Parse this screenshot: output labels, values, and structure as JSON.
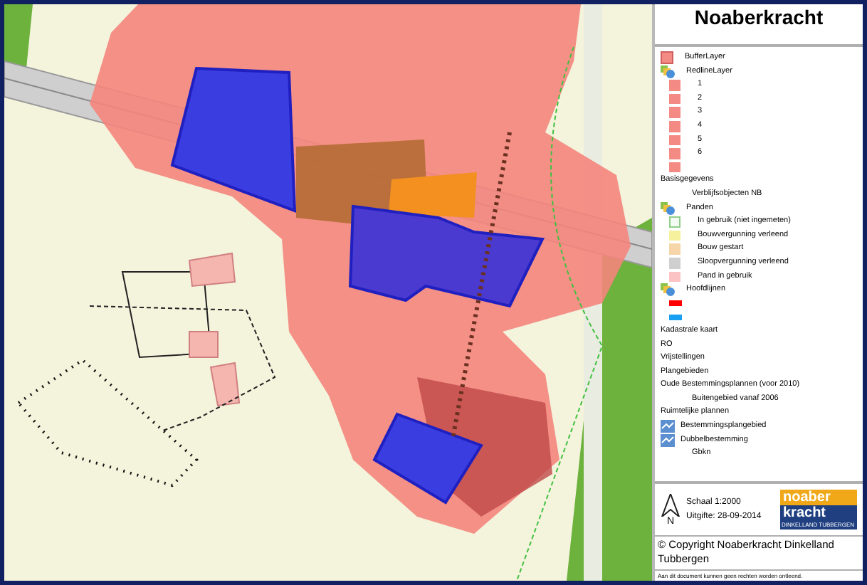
{
  "title": "Noaberkracht",
  "legend": [
    {
      "kind": "swatch",
      "color": "#f48a84",
      "label": "BufferLayer"
    },
    {
      "kind": "group",
      "label": "RedlineLayer"
    },
    {
      "kind": "subswatch",
      "color": "#f48a84",
      "label": "1"
    },
    {
      "kind": "subswatch",
      "color": "#f48a84",
      "label": "2"
    },
    {
      "kind": "subswatch",
      "color": "#f48a84",
      "label": "3"
    },
    {
      "kind": "subswatch",
      "color": "#f48a84",
      "label": "4"
    },
    {
      "kind": "subswatch",
      "color": "#f48a84",
      "label": "5"
    },
    {
      "kind": "subswatch",
      "color": "#f48a84",
      "label": "6"
    },
    {
      "kind": "subswatch",
      "color": "#f48a84"
    },
    {
      "kind": "text",
      "label": "Basisgegevens"
    },
    {
      "kind": "indent",
      "label": "Verblijfsobjecten NB"
    },
    {
      "kind": "group",
      "label": "Panden"
    },
    {
      "kind": "outline",
      "color": "#8fcf8a",
      "label": "In gebruik (niet ingemeten)"
    },
    {
      "kind": "subswatch",
      "color": "#f6f19c",
      "label": "Bouwvergunning verleend"
    },
    {
      "kind": "subswatch",
      "color": "#f6d5a8",
      "label": "Bouw gestart"
    },
    {
      "kind": "subswatch",
      "color": "#cfcfcf",
      "label": "Sloopvergunning verleend"
    },
    {
      "kind": "subswatch",
      "color": "#fbc3c3",
      "label": "Pand in gebruik"
    },
    {
      "kind": "group",
      "label": "Hoofdlijnen"
    },
    {
      "kind": "bar",
      "color": "#ff0000"
    },
    {
      "kind": "bar",
      "color": "#1aa0f0"
    },
    {
      "kind": "text",
      "label": "Kadastrale kaart"
    },
    {
      "kind": "text",
      "label": "RO"
    },
    {
      "kind": "text",
      "label": "Vrijstellingen"
    },
    {
      "kind": "text",
      "label": "Plangebieden"
    },
    {
      "kind": "text",
      "label": "Oude Bestemmingsplannen (voor 2010)"
    },
    {
      "kind": "indent",
      "label": "Buitengebied vanaf 2006"
    },
    {
      "kind": "text",
      "label": "Ruimtelijke plannen"
    },
    {
      "kind": "layer",
      "label": "Bestemmingsplangebied"
    },
    {
      "kind": "layer",
      "label": "Dubbelbestemming"
    },
    {
      "kind": "indent",
      "label": "Gbkn"
    }
  ],
  "scale": "Schaal 1:2000",
  "issued": "Uitgifte: 28-09-2014",
  "north": "N",
  "logo": {
    "top": "noaber",
    "bottom": "kracht",
    "sub": "DINKELLAND TUBBERGEN"
  },
  "copyright": "© Copyright Noaberkracht Dinkelland Tubbergen",
  "disclaimer": "Aan dit document kunnen geen rechten worden ontleend."
}
